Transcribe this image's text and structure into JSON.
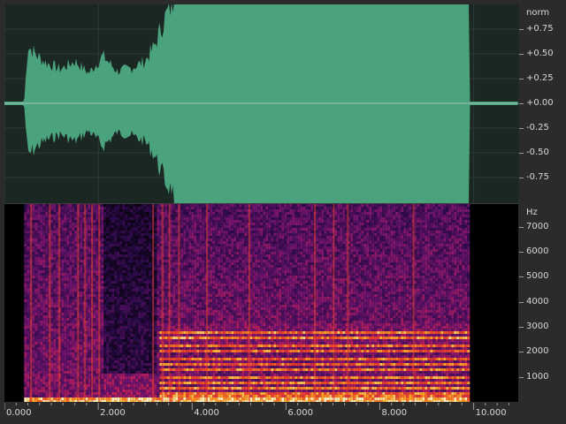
{
  "amplitude_ruler": {
    "unit": "norm",
    "ticks": [
      "+0.75",
      "+0.50",
      "+0.25",
      "+0.00",
      "-0.25",
      "-0.50",
      "-0.75"
    ],
    "tick_values": [
      0.75,
      0.5,
      0.25,
      0.0,
      -0.25,
      -0.5,
      -0.75
    ]
  },
  "frequency_ruler": {
    "unit": "Hz",
    "ticks": [
      "7000",
      "6000",
      "5000",
      "4000",
      "3000",
      "2000",
      "1000"
    ],
    "tick_values": [
      7000,
      6000,
      5000,
      4000,
      3000,
      2000,
      1000
    ],
    "max_hz": 7900
  },
  "time_ruler": {
    "ticks": [
      "0.000",
      "2.000",
      "4.000",
      "6.000",
      "8.000",
      "10.000"
    ],
    "tick_values": [
      0,
      2,
      4,
      6,
      8,
      10
    ],
    "visible_range": [
      0,
      10.95
    ],
    "clip_range": [
      0.42,
      9.9
    ]
  },
  "colors": {
    "waveform_fill": "#4ba37e",
    "waveform_bg": "#1b2723",
    "spectrogram_low": "#000000",
    "spectrogram_high": "#fff0c0"
  },
  "waveform_envelope": [
    [
      0.0,
      0.0
    ],
    [
      0.42,
      0.0
    ],
    [
      0.5,
      0.55
    ],
    [
      0.7,
      0.45
    ],
    [
      0.9,
      0.38
    ],
    [
      1.2,
      0.32
    ],
    [
      1.5,
      0.4
    ],
    [
      1.8,
      0.28
    ],
    [
      2.1,
      0.45
    ],
    [
      2.4,
      0.3
    ],
    [
      2.7,
      0.33
    ],
    [
      3.0,
      0.4
    ],
    [
      3.2,
      0.55
    ],
    [
      3.4,
      0.8
    ],
    [
      3.6,
      1.0
    ],
    [
      9.9,
      1.0
    ],
    [
      9.9,
      0.0
    ],
    [
      10.95,
      0.0
    ]
  ]
}
